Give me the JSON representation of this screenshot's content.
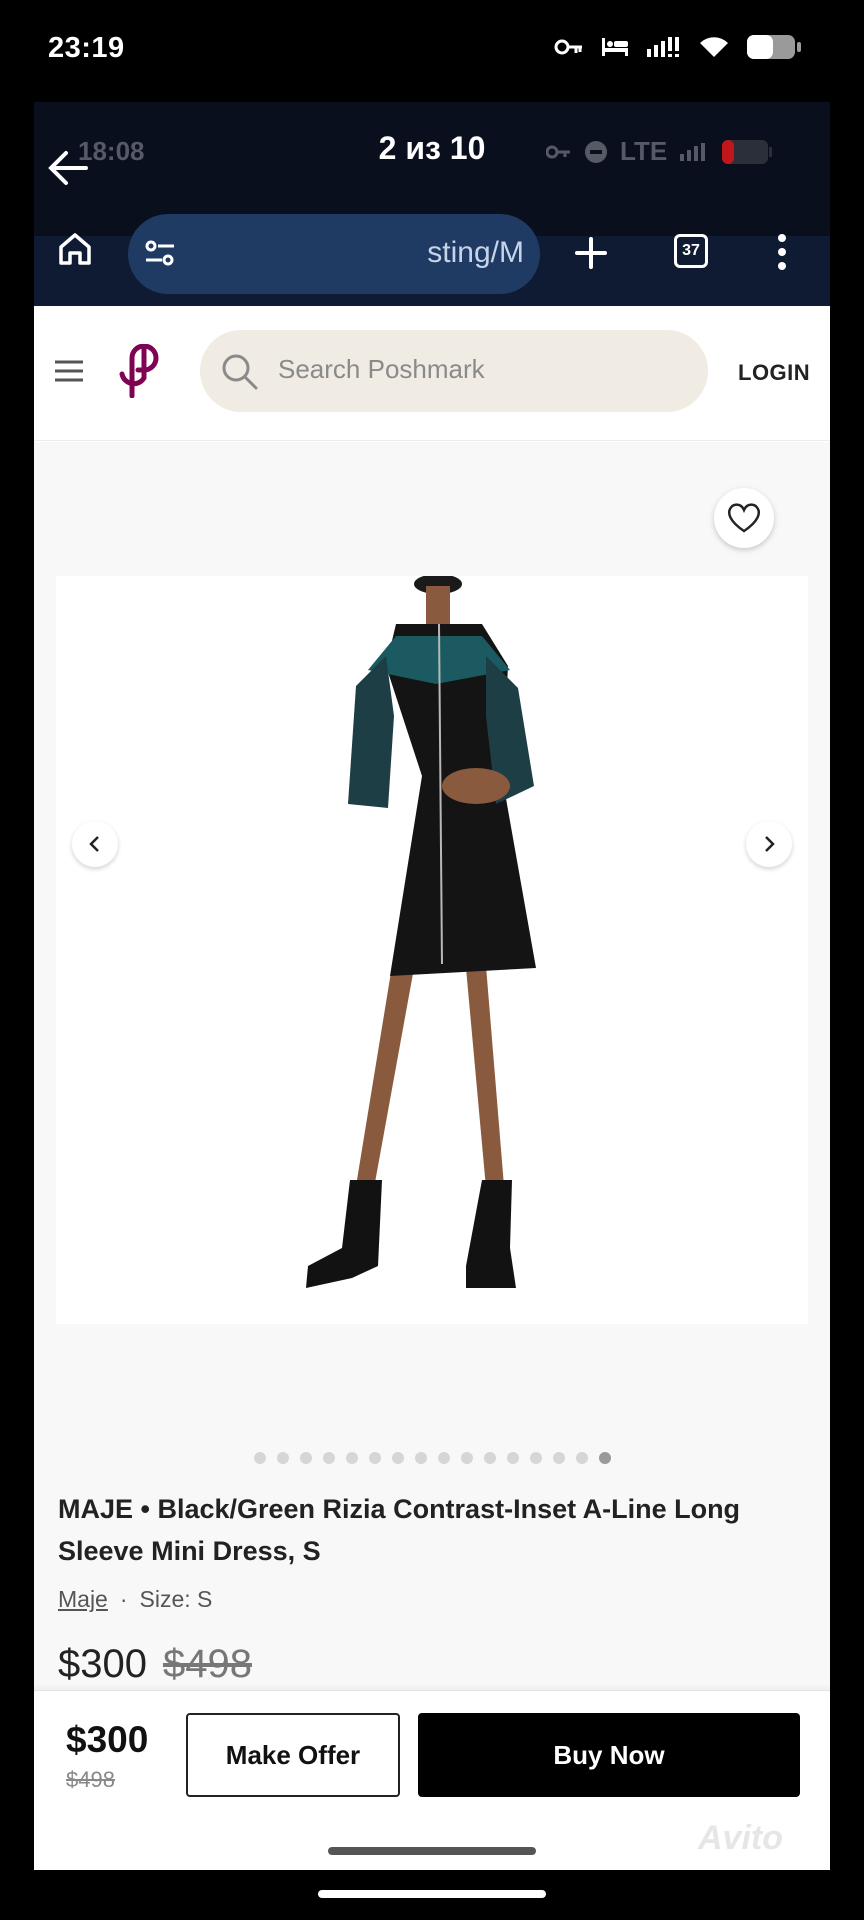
{
  "status_bar": {
    "time": "23:19",
    "icons": [
      "key-icon",
      "bed-icon",
      "signal-icon",
      "wifi-icon",
      "battery-icon"
    ]
  },
  "viewer": {
    "counter": "2 из 10",
    "inner_time": "18:08",
    "inner_network": "LTE",
    "watermark": "Avito"
  },
  "browser": {
    "url": "sting/M",
    "tab_count": "37"
  },
  "site": {
    "search_placeholder": "Search Poshmark",
    "login_label": "LOGIN",
    "brand_color": "#7f0353"
  },
  "gallery": {
    "photo_count": 16,
    "active_index": 15
  },
  "listing": {
    "title": "MAJE • Black/Green Rizia Contrast-Inset A-Line Long Sleeve Mini Dress, S",
    "brand": "Maje",
    "separator": "·",
    "size": "Size: S",
    "price": "$300",
    "original_price": "$498"
  },
  "actions": {
    "make_offer": "Make Offer",
    "buy_now": "Buy Now"
  }
}
